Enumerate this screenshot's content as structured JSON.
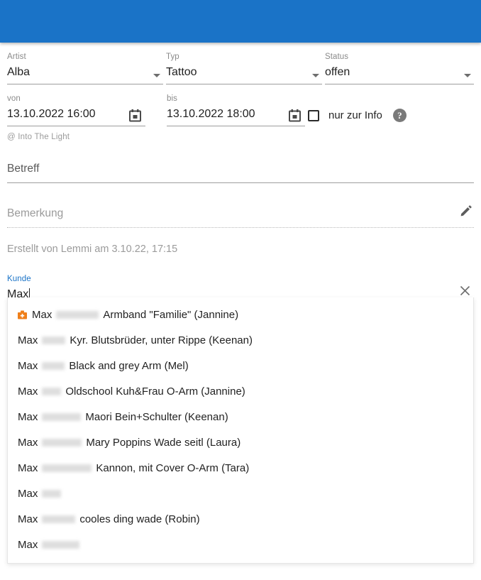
{
  "appbar": {
    "title": ""
  },
  "colors": {
    "appbar_blue": "#1a73c7",
    "focus_blue": "#1a73c7",
    "kit_icon_orange": "#ef7f1a",
    "help_gray": "#7a7a7a"
  },
  "form": {
    "artist": {
      "label": "Artist",
      "value": "Alba"
    },
    "typ": {
      "label": "Typ",
      "value": "Tattoo"
    },
    "status": {
      "label": "Status",
      "value": "offen"
    },
    "von": {
      "label": "von",
      "value": "13.10.2022 16:00"
    },
    "bis": {
      "label": "bis",
      "value": "13.10.2022 18:00"
    },
    "info_only": {
      "label": "nur zur Info",
      "checked": false,
      "help": "?"
    },
    "location": "@ Into The Light",
    "betreff": {
      "placeholder": "Betreff",
      "value": ""
    },
    "bemerkung": {
      "placeholder": "Bemerkung",
      "value": ""
    },
    "created_info": "Erstellt von Lemmi am 3.10.22, 17:15",
    "kunde": {
      "label": "Kunde",
      "value": "Max",
      "clear": "×"
    }
  },
  "suggestions": [
    {
      "first": "Max",
      "surname": "█████████",
      "surname_width": 60,
      "rest": "Armband \"Familie\" (Jannine)",
      "has_kit_icon": true
    },
    {
      "first": "Max",
      "surname": "█████",
      "surname_width": 33,
      "rest": "Kyr. Blutsbrüder, unter Rippe (Keenan)",
      "has_kit_icon": false
    },
    {
      "first": "Max",
      "surname": "█████",
      "surname_width": 32,
      "rest": "Black and grey Arm (Mel)",
      "has_kit_icon": false
    },
    {
      "first": "Max",
      "surname": "████",
      "surname_width": 27,
      "rest": "Oldschool Kuh&Frau O-Arm (Jannine)",
      "has_kit_icon": false
    },
    {
      "first": "Max",
      "surname": "████████",
      "surname_width": 55,
      "rest": "Maori Bein+Schulter (Keenan)",
      "has_kit_icon": false
    },
    {
      "first": "Max",
      "surname": "████████",
      "surname_width": 56,
      "rest": "Mary Poppins Wade seitl (Laura)",
      "has_kit_icon": false
    },
    {
      "first": "Max",
      "surname": "██████████",
      "surname_width": 70,
      "rest": "Kannon, mit Cover O-Arm (Tara)",
      "has_kit_icon": false
    },
    {
      "first": "Max",
      "surname": "████",
      "surname_width": 27,
      "rest": "",
      "has_kit_icon": false
    },
    {
      "first": "Max",
      "surname": "███████",
      "surname_width": 47,
      "rest": "cooles ding wade (Robin)",
      "has_kit_icon": false
    },
    {
      "first": "Max",
      "surname": "████████",
      "surname_width": 53,
      "rest": "",
      "has_kit_icon": false
    }
  ]
}
